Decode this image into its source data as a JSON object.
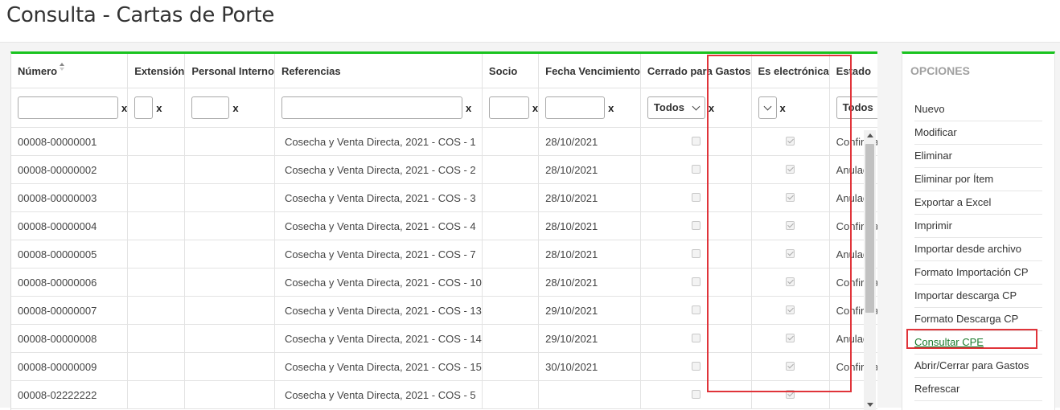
{
  "page": {
    "title": "Consulta - Cartas de Porte"
  },
  "grid": {
    "columns": [
      {
        "key": "numero",
        "label": "Número",
        "sortable": true
      },
      {
        "key": "extension",
        "label": "Extensión"
      },
      {
        "key": "personal",
        "label": "Personal Interno"
      },
      {
        "key": "referencias",
        "label": "Referencias"
      },
      {
        "key": "socio",
        "label": "Socio"
      },
      {
        "key": "fecha_vencimiento",
        "label": "Fecha Vencimiento"
      },
      {
        "key": "cerrado",
        "label": "Cerrado para Gastos"
      },
      {
        "key": "es_electronica",
        "label": "Es electrónica"
      },
      {
        "key": "estado",
        "label": "Estado"
      }
    ],
    "filters": {
      "cerrado_value": "Todos",
      "estado_value": "Todos",
      "clear_label": "x"
    },
    "rows": [
      {
        "numero": "00008-00000001",
        "referencias": "Cosecha y Venta Directa, 2021 - COS - 1",
        "fecha": "28/10/2021",
        "cerrado": false,
        "electronica": true,
        "estado": "Confirmada definitivamente"
      },
      {
        "numero": "00008-00000002",
        "referencias": "Cosecha y Venta Directa, 2021 - COS - 2",
        "fecha": "28/10/2021",
        "cerrado": false,
        "electronica": true,
        "estado": "Anulada"
      },
      {
        "numero": "00008-00000003",
        "referencias": "Cosecha y Venta Directa, 2021 - COS - 3",
        "fecha": "28/10/2021",
        "cerrado": false,
        "electronica": true,
        "estado": "Anulada"
      },
      {
        "numero": "00008-00000004",
        "referencias": "Cosecha y Venta Directa, 2021 - COS - 4",
        "fecha": "28/10/2021",
        "cerrado": false,
        "electronica": true,
        "estado": "Confirmada definitivamente"
      },
      {
        "numero": "00008-00000005",
        "referencias": "Cosecha y Venta Directa, 2021 - COS - 7",
        "fecha": "28/10/2021",
        "cerrado": false,
        "electronica": true,
        "estado": "Anulada"
      },
      {
        "numero": "00008-00000006",
        "referencias": "Cosecha y Venta Directa, 2021 - COS - 10",
        "fecha": "28/10/2021",
        "cerrado": false,
        "electronica": true,
        "estado": "Confirmada definitivamente"
      },
      {
        "numero": "00008-00000007",
        "referencias": "Cosecha y Venta Directa, 2021 - COS - 13",
        "fecha": "29/10/2021",
        "cerrado": false,
        "electronica": true,
        "estado": "Confirmada definitivamente"
      },
      {
        "numero": "00008-00000008",
        "referencias": "Cosecha y Venta Directa, 2021 - COS - 14",
        "fecha": "29/10/2021",
        "cerrado": false,
        "electronica": true,
        "estado": "Anulada"
      },
      {
        "numero": "00008-00000009",
        "referencias": "Cosecha y Venta Directa, 2021 - COS - 15",
        "fecha": "30/10/2021",
        "cerrado": false,
        "electronica": true,
        "estado": "Confirmada definitivamente"
      },
      {
        "numero": "00008-02222222",
        "referencias": "Cosecha y Venta Directa, 2021 - COS - 5",
        "fecha": "",
        "cerrado": false,
        "electronica": true,
        "estado": ""
      }
    ]
  },
  "options": {
    "title": "OPCIONES",
    "items": [
      {
        "label": "Nuevo"
      },
      {
        "label": "Modificar"
      },
      {
        "label": "Eliminar"
      },
      {
        "label": "Eliminar por Ítem"
      },
      {
        "label": "Exportar a Excel"
      },
      {
        "label": "Imprimir"
      },
      {
        "label": "Importar desde archivo"
      },
      {
        "label": "Formato Importación CP"
      },
      {
        "label": "Importar descarga CP"
      },
      {
        "label": "Formato Descarga CP"
      },
      {
        "label": "Consultar CPE",
        "link": true
      },
      {
        "label": "Abrir/Cerrar para Gastos"
      },
      {
        "label": "Refrescar"
      }
    ]
  },
  "colors": {
    "accent": "#19c31f",
    "highlight": "#e0343a",
    "link": "#1b7a2c"
  }
}
